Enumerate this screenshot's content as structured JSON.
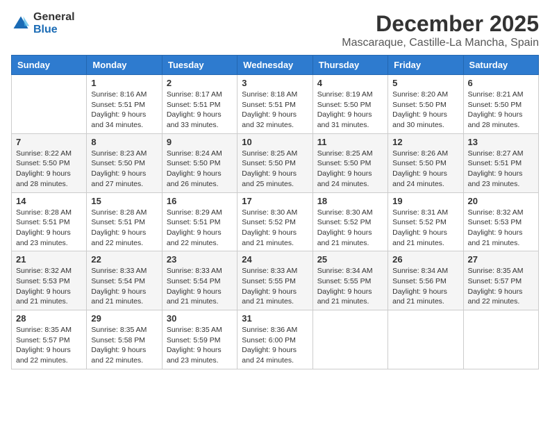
{
  "logo": {
    "general": "General",
    "blue": "Blue"
  },
  "header": {
    "month": "December 2025",
    "location": "Mascaraque, Castille-La Mancha, Spain"
  },
  "weekdays": [
    "Sunday",
    "Monday",
    "Tuesday",
    "Wednesday",
    "Thursday",
    "Friday",
    "Saturday"
  ],
  "weeks": [
    [
      {
        "day": "",
        "info": ""
      },
      {
        "day": "1",
        "info": "Sunrise: 8:16 AM\nSunset: 5:51 PM\nDaylight: 9 hours\nand 34 minutes."
      },
      {
        "day": "2",
        "info": "Sunrise: 8:17 AM\nSunset: 5:51 PM\nDaylight: 9 hours\nand 33 minutes."
      },
      {
        "day": "3",
        "info": "Sunrise: 8:18 AM\nSunset: 5:51 PM\nDaylight: 9 hours\nand 32 minutes."
      },
      {
        "day": "4",
        "info": "Sunrise: 8:19 AM\nSunset: 5:50 PM\nDaylight: 9 hours\nand 31 minutes."
      },
      {
        "day": "5",
        "info": "Sunrise: 8:20 AM\nSunset: 5:50 PM\nDaylight: 9 hours\nand 30 minutes."
      },
      {
        "day": "6",
        "info": "Sunrise: 8:21 AM\nSunset: 5:50 PM\nDaylight: 9 hours\nand 28 minutes."
      }
    ],
    [
      {
        "day": "7",
        "info": "Sunrise: 8:22 AM\nSunset: 5:50 PM\nDaylight: 9 hours\nand 28 minutes."
      },
      {
        "day": "8",
        "info": "Sunrise: 8:23 AM\nSunset: 5:50 PM\nDaylight: 9 hours\nand 27 minutes."
      },
      {
        "day": "9",
        "info": "Sunrise: 8:24 AM\nSunset: 5:50 PM\nDaylight: 9 hours\nand 26 minutes."
      },
      {
        "day": "10",
        "info": "Sunrise: 8:25 AM\nSunset: 5:50 PM\nDaylight: 9 hours\nand 25 minutes."
      },
      {
        "day": "11",
        "info": "Sunrise: 8:25 AM\nSunset: 5:50 PM\nDaylight: 9 hours\nand 24 minutes."
      },
      {
        "day": "12",
        "info": "Sunrise: 8:26 AM\nSunset: 5:50 PM\nDaylight: 9 hours\nand 24 minutes."
      },
      {
        "day": "13",
        "info": "Sunrise: 8:27 AM\nSunset: 5:51 PM\nDaylight: 9 hours\nand 23 minutes."
      }
    ],
    [
      {
        "day": "14",
        "info": "Sunrise: 8:28 AM\nSunset: 5:51 PM\nDaylight: 9 hours\nand 23 minutes."
      },
      {
        "day": "15",
        "info": "Sunrise: 8:28 AM\nSunset: 5:51 PM\nDaylight: 9 hours\nand 22 minutes."
      },
      {
        "day": "16",
        "info": "Sunrise: 8:29 AM\nSunset: 5:51 PM\nDaylight: 9 hours\nand 22 minutes."
      },
      {
        "day": "17",
        "info": "Sunrise: 8:30 AM\nSunset: 5:52 PM\nDaylight: 9 hours\nand 21 minutes."
      },
      {
        "day": "18",
        "info": "Sunrise: 8:30 AM\nSunset: 5:52 PM\nDaylight: 9 hours\nand 21 minutes."
      },
      {
        "day": "19",
        "info": "Sunrise: 8:31 AM\nSunset: 5:52 PM\nDaylight: 9 hours\nand 21 minutes."
      },
      {
        "day": "20",
        "info": "Sunrise: 8:32 AM\nSunset: 5:53 PM\nDaylight: 9 hours\nand 21 minutes."
      }
    ],
    [
      {
        "day": "21",
        "info": "Sunrise: 8:32 AM\nSunset: 5:53 PM\nDaylight: 9 hours\nand 21 minutes."
      },
      {
        "day": "22",
        "info": "Sunrise: 8:33 AM\nSunset: 5:54 PM\nDaylight: 9 hours\nand 21 minutes."
      },
      {
        "day": "23",
        "info": "Sunrise: 8:33 AM\nSunset: 5:54 PM\nDaylight: 9 hours\nand 21 minutes."
      },
      {
        "day": "24",
        "info": "Sunrise: 8:33 AM\nSunset: 5:55 PM\nDaylight: 9 hours\nand 21 minutes."
      },
      {
        "day": "25",
        "info": "Sunrise: 8:34 AM\nSunset: 5:55 PM\nDaylight: 9 hours\nand 21 minutes."
      },
      {
        "day": "26",
        "info": "Sunrise: 8:34 AM\nSunset: 5:56 PM\nDaylight: 9 hours\nand 21 minutes."
      },
      {
        "day": "27",
        "info": "Sunrise: 8:35 AM\nSunset: 5:57 PM\nDaylight: 9 hours\nand 22 minutes."
      }
    ],
    [
      {
        "day": "28",
        "info": "Sunrise: 8:35 AM\nSunset: 5:57 PM\nDaylight: 9 hours\nand 22 minutes."
      },
      {
        "day": "29",
        "info": "Sunrise: 8:35 AM\nSunset: 5:58 PM\nDaylight: 9 hours\nand 22 minutes."
      },
      {
        "day": "30",
        "info": "Sunrise: 8:35 AM\nSunset: 5:59 PM\nDaylight: 9 hours\nand 23 minutes."
      },
      {
        "day": "31",
        "info": "Sunrise: 8:36 AM\nSunset: 6:00 PM\nDaylight: 9 hours\nand 24 minutes."
      },
      {
        "day": "",
        "info": ""
      },
      {
        "day": "",
        "info": ""
      },
      {
        "day": "",
        "info": ""
      }
    ]
  ]
}
